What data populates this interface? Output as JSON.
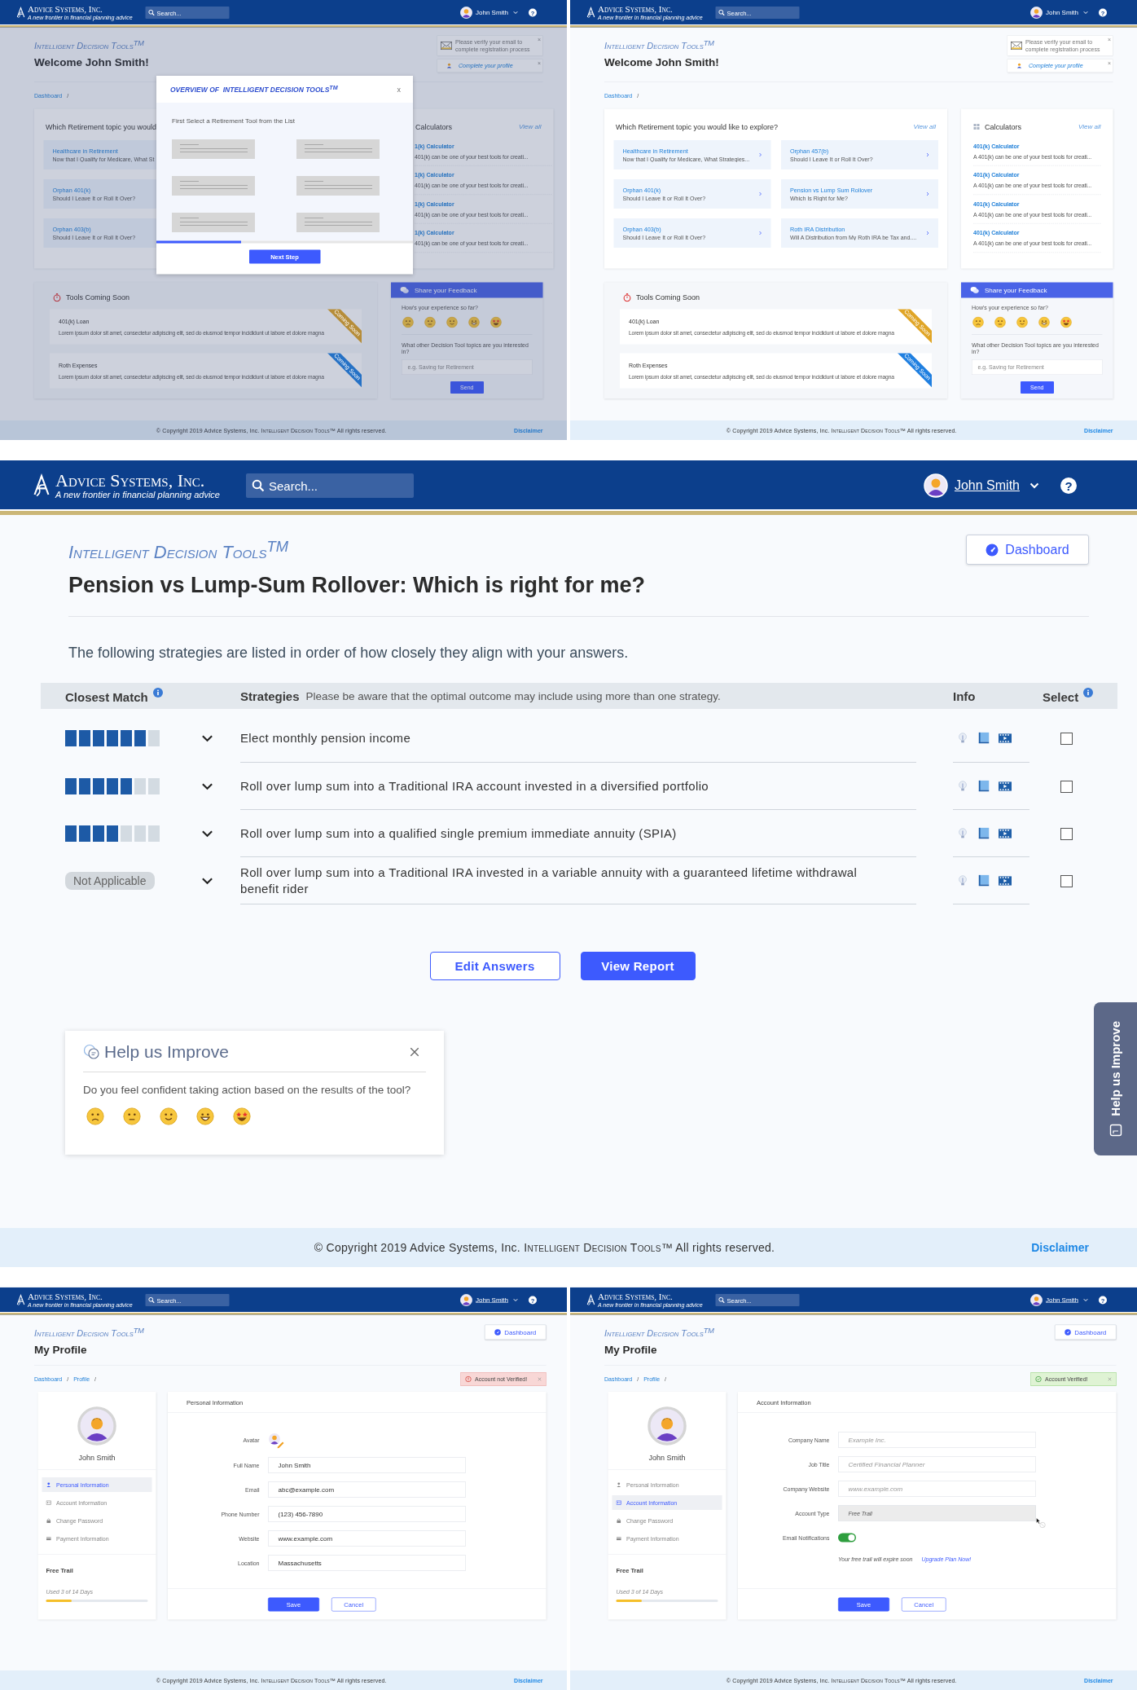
{
  "screens": [
    {
      "kind": "dashboard",
      "header": {
        "brand": "Advice Systems, Inc.",
        "tagline": "A new frontier in financial planning advice",
        "search_placeholder": "Search...",
        "user_name": "John Smith",
        "user_underlined": false,
        "help": "?"
      },
      "product_title": "Intelligent Decision Tools$^{TM}$",
      "heading": "Welcome John Smith!",
      "notices": [
        {
          "kind": "email",
          "text": "Please verify your email to complete registration process",
          "close": "×"
        },
        {
          "kind": "profile",
          "text": "Complete your profile",
          "close": "×"
        }
      ],
      "breadcrumb": {
        "items": [
          "Dashboard"
        ],
        "separator": "/"
      },
      "topics": {
        "title": "Which Retirement topic you would",
        "items": [
          {
            "title": "Healthcare in Retirement",
            "subtitle": "Now that I Qualify for Medicare, What St"
          },
          {
            "title": "Orphan 401(k)",
            "subtitle": "Should I Leave It or Roll It Over?"
          },
          {
            "title": "Orphan 403(b)",
            "subtitle": "Should I Leave It or Roll It Over?"
          }
        ]
      },
      "calculators": {
        "title": "Calculators",
        "view_all": "View all",
        "items": [
          {
            "title": "1(k) Calculator",
            "description": "401(k) can be one of your best tools for creati..."
          },
          {
            "title": "1(k) Calculator",
            "description": "401(k) can be one of your best tools for creati..."
          },
          {
            "title": "1(k) Calculator",
            "description": "401(k) can be one of your best tools for creati..."
          },
          {
            "title": "1(k) Calculator",
            "description": "401(k) can be one of your best tools for creati..."
          }
        ]
      },
      "coming_soon": {
        "title": "Tools Coming Soon",
        "items": [
          {
            "title": "401(k) Loan",
            "description": "Lorem ipsum dolor sit amet, consectetur adipiscing elit, sed do eiusmod tempor incididunt ut labore et dolore magna",
            "ribbon": "Coming Soon",
            "color": "#b68d39"
          },
          {
            "title": "Roth Expenses",
            "description": "Lorem ipsum dolor sit amet, consectetur adipiscing elit, sed do eiusmod tempor incididunt ut labore et dolore magna",
            "ribbon": "Coming Soon",
            "color": "#2571c5"
          }
        ]
      },
      "feedback": {
        "title": "Share your Feedback",
        "question": "How's your experience so far?",
        "topics_question": "What other Decision Tool topics are you interested in?",
        "placeholder": "e.g. Saving for Retirement",
        "send": "Send"
      },
      "modal": {
        "title": "OVERVIEW OF  INTELLIGENT DECISION TOOLS$^{TM}$",
        "close": "x",
        "instruction": "First Select a Retirement Tool from the List",
        "level": 0.33,
        "button": "Next Step"
      },
      "footer": {
        "copyright": "© Copyright 2019 Advice Systems, Inc.",
        "product": "Intelligent Decision Tools™",
        "rights": "All rights reserved.",
        "disclaimer": "Disclaimer"
      }
    },
    {
      "kind": "dashboard",
      "header": {
        "brand": "Advice Systems, Inc.",
        "tagline": "A new frontier in financial planning advice",
        "search_placeholder": "Search...",
        "user_name": "John Smith",
        "user_underlined": false,
        "help": "?"
      },
      "product_title": "Intelligent Decision Tools$^{TM}$",
      "heading": "Welcome John Smith!",
      "notices": [
        {
          "kind": "email",
          "text": "Please verify your email to complete registration process",
          "close": "×"
        },
        {
          "kind": "profile",
          "text": "Complete your profile",
          "close": "×"
        }
      ],
      "breadcrumb": {
        "items": [
          "Dashboard"
        ],
        "separator": "/"
      },
      "topics": {
        "title": "Which Retirement topic you would like to explore?",
        "view_all": "View all",
        "items": [
          {
            "title": "Healthcare in Retirement",
            "subtitle": "Now that I Qualify for Medicare, What Strategies..."
          },
          {
            "title": "Orphan 457(b)",
            "subtitle": "Should I Leave It or Roll It Over?"
          },
          {
            "title": "Orphan 401(k)",
            "subtitle": "Should I Leave It or Roll It Over?"
          },
          {
            "title": "Pension vs Lump Sum Rollover",
            "subtitle": "Which Is Right for Me?"
          },
          {
            "title": "Orphan 403(b)",
            "subtitle": "Should I Leave It or Roll It Over?"
          },
          {
            "title": "Roth IRA Distribution",
            "subtitle": "Will A Distribution from My Roth IRA be Tax and...."
          }
        ]
      },
      "calculators": {
        "title": "Calculators",
        "view_all": "View all",
        "items": [
          {
            "title": "401(k) Calculator",
            "description": "A 401(k) can be one of your best tools for creati..."
          },
          {
            "title": "401(k) Calculator",
            "description": "A 401(k) can be one of your best tools for creati..."
          },
          {
            "title": "401(k) Calculator",
            "description": "A 401(k) can be one of your best tools for creati..."
          },
          {
            "title": "401(k) Calculator",
            "description": "A 401(k) can be one of your best tools for creati..."
          }
        ]
      },
      "coming_soon": {
        "title": "Tools Coming Soon",
        "items": [
          {
            "title": "401(k) Loan",
            "description": "Lorem ipsum dolor sit amet, consectetur adipiscing elit, sed do eiusmod tempor incididunt ut labore et dolore magna",
            "ribbon": "Coming Soon",
            "color": "#e0a526"
          },
          {
            "title": "Roth Expenses",
            "description": "Lorem ipsum dolor sit amet, consectetur adipiscing elit, sed do eiusmod tempor incididunt ut labore et dolore magna",
            "ribbon": "Coming Soon",
            "color": "#1f7fe0"
          }
        ]
      },
      "feedback": {
        "title": "Share your Feedback",
        "question": "How's your experience so far?",
        "topics_question": "What other Decision Tool topics are you interested in?",
        "placeholder": "e.g. Saving for Retirement",
        "send": "Send"
      },
      "footer": {
        "copyright": "© Copyright 2019 Advice Systems, Inc.",
        "product": "Intelligent Decision Tools™",
        "rights": "All rights reserved.",
        "disclaimer": "Disclaimer"
      }
    },
    {
      "kind": "results",
      "header": {
        "brand": "Advice Systems, Inc.",
        "tagline": "A new frontier in financial planning advice",
        "search_placeholder": "Search...",
        "user_name": "John Smith",
        "user_underlined": true,
        "help": "?"
      },
      "product_title": "Intelligent Decision Tools$^{TM}$",
      "heading": "Pension vs Lump-Sum Rollover: Which is right for me?",
      "dashboard_button": "Dashboard",
      "intro": "The following strategies are listed in order of how closely they align with your answers.",
      "table": {
        "columns": [
          {
            "label": "Closest Match",
            "info": true
          },
          {
            "label": "Strategies",
            "note": "Please be aware that the optimal outcome may include using more than one strategy.",
            "info": false
          },
          {
            "label": "Info",
            "info": false
          },
          {
            "label": "Select",
            "info": true
          }
        ],
        "rows": [
          {
            "kind": "match_bars",
            "level": 0.86,
            "strategy": "Elect monthly pension income",
            "checked": false
          },
          {
            "kind": "match_bars",
            "level": 0.71,
            "strategy": "Roll over lump sum into a Traditional IRA account invested in a diversified portfolio",
            "checked": false
          },
          {
            "kind": "match_bars",
            "level": 0.57,
            "strategy": "Roll over lump sum into a qualified single premium immediate annuity (SPIA)",
            "checked": false
          },
          {
            "kind": "not_applicable",
            "badge": "Not Applicable",
            "strategy": "Roll over lump sum into a Traditional IRA invested in a variable annuity with a guaranteed lifetime withdrawal benefit rider",
            "checked": false
          }
        ]
      },
      "actions": [
        {
          "kind": "outline",
          "label": "Edit Answers"
        },
        {
          "kind": "primary",
          "label": "View Report"
        }
      ],
      "help_card": {
        "title": "Help us Improve",
        "question": "Do you feel confident taking action based on the results of the tool?"
      },
      "side_tab": {
        "label": "Help us Improve"
      },
      "footer": {
        "copyright": "© Copyright 2019 Advice Systems, Inc.",
        "product": "Intelligent Decision Tools™",
        "rights": "All rights reserved.",
        "disclaimer": "Disclaimer"
      }
    },
    {
      "kind": "profile",
      "header": {
        "brand": "Advice Systems, Inc.",
        "tagline": "A new frontier in financial planning advice",
        "search_placeholder": "Search...",
        "user_name": "John Smith",
        "user_underlined": true,
        "help": "?"
      },
      "product_title": "Intelligent Decision Tools$^{TM}$",
      "heading": "My Profile",
      "dashboard_button": "Dashboard",
      "breadcrumb": {
        "items": [
          "Dashboard",
          "Profile"
        ],
        "separator": "/"
      },
      "alert": {
        "kind": "error",
        "text": "Account not Verified!"
      },
      "profile": {
        "name": "John Smith",
        "menu": [
          {
            "label": "Personal Information",
            "selected": true
          },
          {
            "label": "Account Information",
            "selected": false
          },
          {
            "label": "Change Password",
            "selected": false
          },
          {
            "label": "Payment Information",
            "selected": false
          }
        ],
        "trial": {
          "title": "Free Trail",
          "usage": "Used 3 of 14 Days",
          "level": 0.25
        }
      },
      "form": {
        "title": "Personal Information",
        "fields": [
          {
            "kind": "avatar",
            "label": "Avatar"
          },
          {
            "kind": "text",
            "label": "Full Name",
            "value": "John Smith",
            "disabled": false
          },
          {
            "kind": "text",
            "label": "Email",
            "value": "abc@example.com",
            "disabled": false
          },
          {
            "kind": "text",
            "label": "Phone Number",
            "value": "(123) 456-7890",
            "disabled": false
          },
          {
            "kind": "text",
            "label": "Website",
            "value": "www.example.com",
            "disabled": false
          },
          {
            "kind": "text",
            "label": "Location",
            "value": "Massachusetts",
            "disabled": false
          }
        ],
        "buttons": [
          {
            "kind": "primary",
            "label": "Save"
          },
          {
            "kind": "outline",
            "label": "Cancel"
          }
        ]
      },
      "footer": {
        "copyright": "© Copyright 2019 Advice Systems, Inc.",
        "product": "Intelligent Decision Tools™",
        "rights": "All rights reserved.",
        "disclaimer": "Disclaimer"
      }
    },
    {
      "kind": "profile",
      "header": {
        "brand": "Advice Systems, Inc.",
        "tagline": "A new frontier in financial planning advice",
        "search_placeholder": "Search...",
        "user_name": "John Smith",
        "user_underlined": true,
        "help": "?"
      },
      "product_title": "Intelligent Decision Tools$^{TM}$",
      "heading": "My Profile",
      "dashboard_button": "Dashboard",
      "breadcrumb": {
        "items": [
          "Dashboard",
          "Profile"
        ],
        "separator": "/"
      },
      "alert": {
        "kind": "success",
        "text": "Account Verified!"
      },
      "profile": {
        "name": "John Smith",
        "menu": [
          {
            "label": "Personal Information",
            "selected": false
          },
          {
            "label": "Account Information",
            "selected": true
          },
          {
            "label": "Change Password",
            "selected": false
          },
          {
            "label": "Payment Information",
            "selected": false
          }
        ],
        "trial": {
          "title": "Free Trail",
          "usage": "Used 3 of 14 Days",
          "level": 0.25
        }
      },
      "form": {
        "title": "Account Information",
        "fields": [
          {
            "kind": "text",
            "label": "Company Name",
            "placeholder": "Example Inc.",
            "disabled": false
          },
          {
            "kind": "text",
            "label": "Job Title",
            "placeholder": "Certified Financial Planner",
            "disabled": false
          },
          {
            "kind": "text",
            "label": "Company Website",
            "placeholder": "www.example.com",
            "disabled": false
          },
          {
            "kind": "text",
            "label": "Account Type",
            "value": "Free Trail",
            "disabled": true
          },
          {
            "kind": "toggle",
            "label": "Email Notifications",
            "on": true
          },
          {
            "kind": "note",
            "text": "Your free trail will expire soon",
            "link": "Upgrade Plan Now!"
          }
        ],
        "buttons": [
          {
            "kind": "primary",
            "label": "Save"
          },
          {
            "kind": "outline",
            "label": "Cancel"
          }
        ]
      },
      "footer": {
        "copyright": "© Copyright 2019 Advice Systems, Inc.",
        "product": "Intelligent Decision Tools™",
        "rights": "All rights reserved.",
        "disclaimer": "Disclaimer"
      }
    }
  ]
}
